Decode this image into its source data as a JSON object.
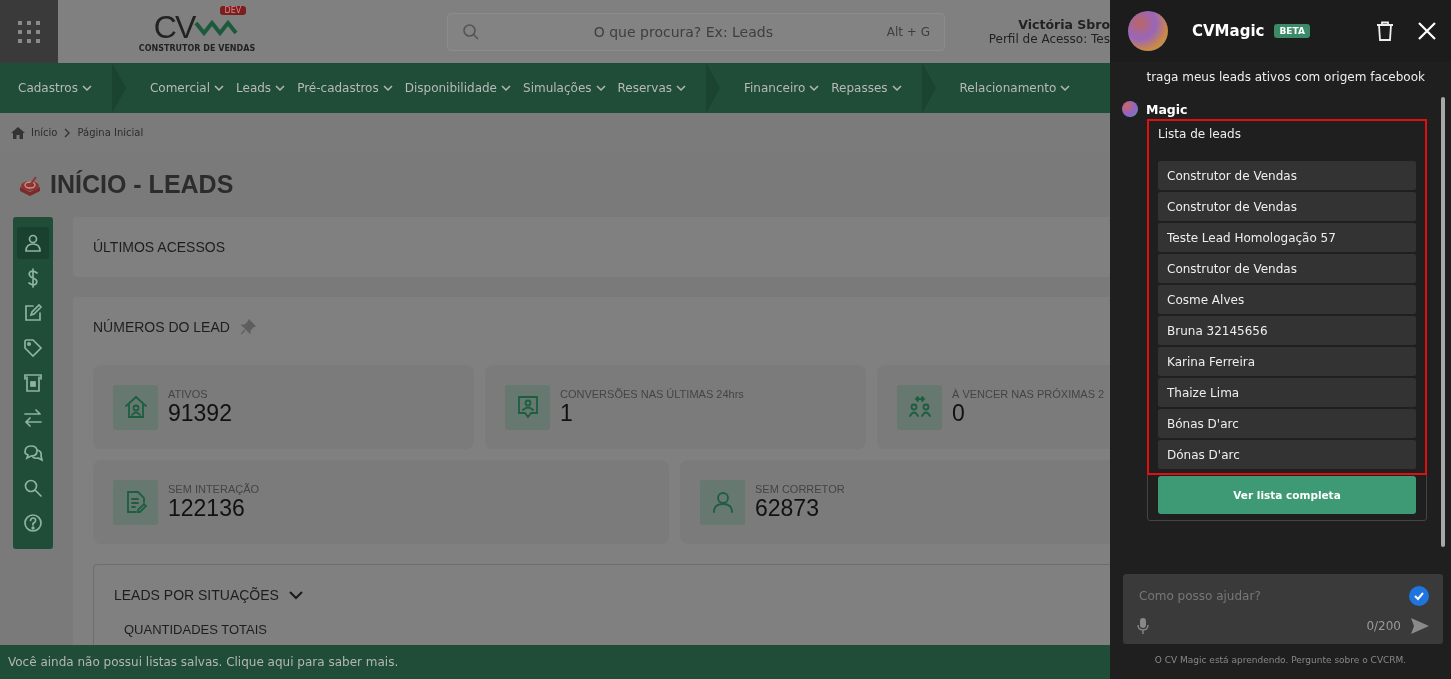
{
  "header": {
    "logo": {
      "mark": "CV",
      "badge": "DEV",
      "tagline": "CONSTRUTOR DE VENDAS"
    },
    "search": {
      "placeholder": "O que procura? Ex: Leads",
      "shortcut": "Alt + G"
    },
    "user": {
      "name": "Victória Sbro",
      "profile": "Perfil de Acesso: Tes"
    }
  },
  "nav": {
    "groups": [
      [
        "Cadastros"
      ],
      [
        "Comercial",
        "Leads",
        "Pré-cadastros",
        "Disponibilidade",
        "Simulações",
        "Reservas"
      ],
      [
        "Financeiro",
        "Repasses"
      ],
      [
        "Relacionamento"
      ]
    ]
  },
  "breadcrumb": [
    "Início",
    "Página Inicial"
  ],
  "page_title": "INÍCIO - LEADS",
  "sidebar": {
    "items": [
      {
        "selected": true
      },
      {
        "selected": false
      },
      {
        "selected": false
      },
      {
        "selected": false
      },
      {
        "selected": false
      },
      {
        "selected": false
      },
      {
        "selected": false
      },
      {
        "selected": false
      },
      {
        "selected": false
      }
    ]
  },
  "recent": {
    "title": "ÚLTIMOS ACESSOS"
  },
  "numbers": {
    "title": "NÚMEROS DO LEAD",
    "rows": [
      [
        {
          "label": "ATIVOS",
          "value": "91392"
        },
        {
          "label": "CONVERSÕES NAS ÚLTIMAS 24hrs",
          "value": "1"
        },
        {
          "label": "À VENCER NAS PRÓXIMAS 2",
          "value": "0"
        }
      ],
      [
        {
          "label": "SEM INTERAÇÃO",
          "value": "122136"
        },
        {
          "label": "SEM CORRETOR",
          "value": "62873"
        }
      ]
    ]
  },
  "situations": {
    "title": "LEADS POR SITUAÇÕES",
    "subtitle": "QUANTIDADES TOTAIS"
  },
  "bottom_bar": "Você ainda não possui listas salvas. Clique aqui para saber mais.",
  "chat": {
    "title": "CVMagic",
    "badge": "BETA",
    "user_message": "traga meus leads ativos com origem facebook",
    "bot_name": "Magic",
    "list_title": "Lista de leads",
    "leads": [
      "Construtor de Vendas",
      "Construtor de Vendas",
      "Teste Lead Homologação 57",
      "Construtor de Vendas",
      "Cosme Alves",
      "Bruna 32145656",
      "Karina Ferreira",
      "Thaize Lima",
      "Bónas D'arc",
      "Dónas D'arc"
    ],
    "list_button": "Ver lista completa",
    "input": {
      "placeholder": "Como posso ajudar?",
      "counter": "0/200"
    },
    "footer": "O CV Magic está aprendendo. Pergunte sobre o CVCRM."
  }
}
